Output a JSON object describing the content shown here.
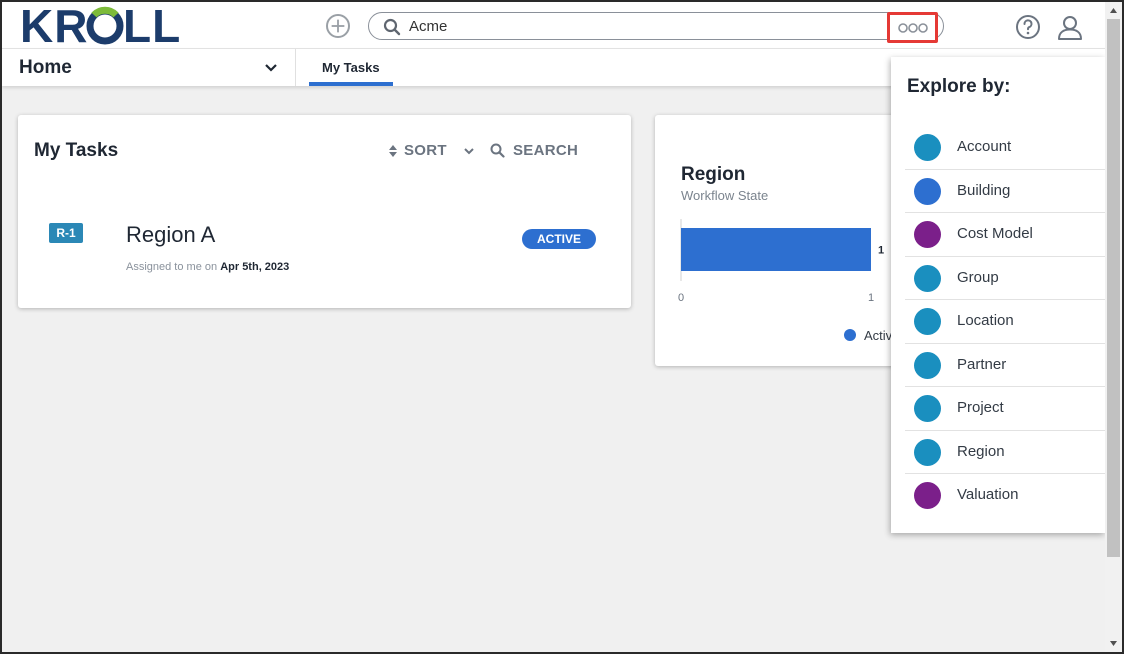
{
  "header": {
    "logo_text": "KROLL",
    "search": {
      "value": "Acme",
      "placeholder": ""
    },
    "icons": {
      "add": "plus-circle-icon",
      "search": "search-icon",
      "explore": "more-circles-icon",
      "help": "help-circle-icon",
      "user": "user-icon"
    },
    "colors": {
      "logo": "#1c3c6b",
      "logo_accent": "#7dbb3a",
      "highlight_border": "#e53935"
    }
  },
  "subnav": {
    "home_label": "Home",
    "tabs": [
      {
        "label": "My Tasks",
        "active": true
      }
    ],
    "accent": "#2d6fd0"
  },
  "tasks_card": {
    "title": "My Tasks",
    "sort_label": "SORT",
    "search_label": "SEARCH",
    "tasks": [
      {
        "id": "R-1",
        "name": "Region A",
        "assigned_prefix": "Assigned to me on",
        "date": "Apr 5th, 2023",
        "status": "ACTIVE"
      }
    ]
  },
  "region_card": {
    "title": "Region",
    "subtitle": "Workflow State"
  },
  "chart_data": {
    "type": "bar",
    "orientation": "horizontal",
    "title": "Region",
    "subtitle": "Workflow State",
    "categories": [
      "Active"
    ],
    "series": [
      {
        "name": "Active",
        "values": [
          1
        ],
        "color": "#2d6fd0"
      }
    ],
    "data_labels": [
      "1"
    ],
    "xlim": [
      0,
      1
    ],
    "x_ticks": [
      "0",
      "1"
    ],
    "legend": {
      "entries": [
        "Activ"
      ],
      "placement": "bottom"
    },
    "grid": false
  },
  "explore_panel": {
    "heading": "Explore by:",
    "items": [
      {
        "label": "Account",
        "color": "#1a8fbf"
      },
      {
        "label": "Building",
        "color": "#2d6fd0"
      },
      {
        "label": "Cost Model",
        "color": "#7b1f8a"
      },
      {
        "label": "Group",
        "color": "#1a8fbf"
      },
      {
        "label": "Location",
        "color": "#1a8fbf"
      },
      {
        "label": "Partner",
        "color": "#1a8fbf"
      },
      {
        "label": "Project",
        "color": "#1a8fbf"
      },
      {
        "label": "Region",
        "color": "#1a8fbf"
      },
      {
        "label": "Valuation",
        "color": "#7b1f8a"
      }
    ]
  }
}
